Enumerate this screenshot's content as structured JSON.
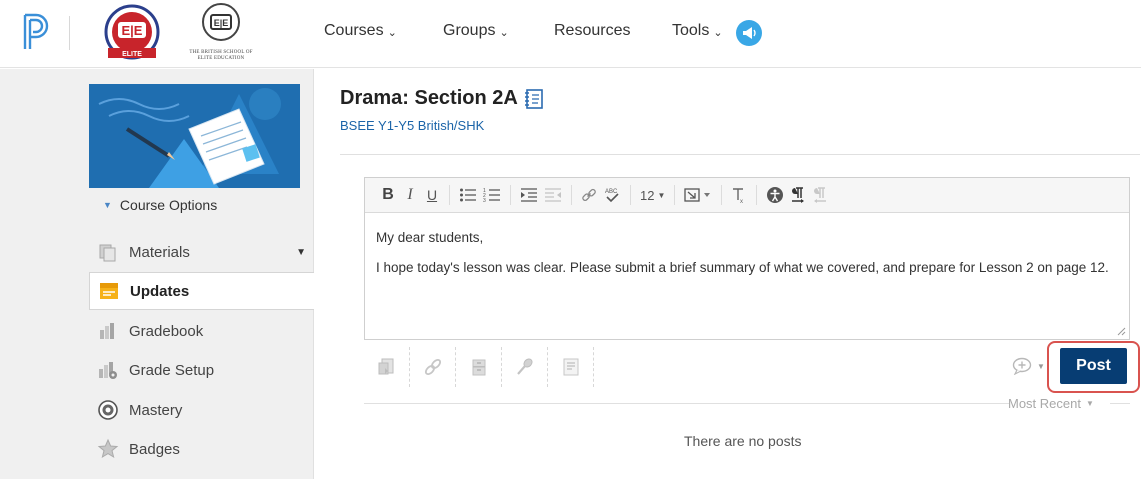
{
  "header": {
    "school_crest_text": "THE BRITISH SCHOOL OF ELITE EDUCATION",
    "badge_text": "ELITE",
    "nav": [
      {
        "label": "Courses",
        "has_dropdown": true
      },
      {
        "label": "Groups",
        "has_dropdown": true
      },
      {
        "label": "Resources",
        "has_dropdown": false
      },
      {
        "label": "Tools",
        "has_dropdown": true
      }
    ],
    "icons": {
      "logo": "schoology-logo-icon",
      "notify": "megaphone-icon"
    }
  },
  "sidebar": {
    "course_options": "Course Options",
    "items": [
      {
        "label": "Materials",
        "icon": "materials-icon",
        "active": false,
        "dropdown": true
      },
      {
        "label": "Updates",
        "icon": "updates-icon",
        "active": true
      },
      {
        "label": "Gradebook",
        "icon": "gradebook-icon",
        "active": false
      },
      {
        "label": "Grade Setup",
        "icon": "grade-setup-icon",
        "active": false
      },
      {
        "label": "Mastery",
        "icon": "mastery-icon",
        "active": false
      },
      {
        "label": "Badges",
        "icon": "badges-icon",
        "active": false
      }
    ]
  },
  "main": {
    "title": "Drama: Section 2A",
    "subtitle": "BSEE Y1-Y5 British/SHK",
    "editor": {
      "font_size": "12",
      "paragraphs": [
        "My dear students,",
        "I hope today's lesson was clear. Please submit a brief summary of what we covered, and prepare for Lesson 2 on page 12."
      ]
    },
    "post_label": "Post",
    "sort_label": "Most Recent",
    "empty_text": "There are no posts"
  },
  "colors": {
    "primary_button": "#073d73",
    "highlight": "#d9534f",
    "link": "#1b64a8",
    "course_art_bg": "#1f6eb0"
  }
}
